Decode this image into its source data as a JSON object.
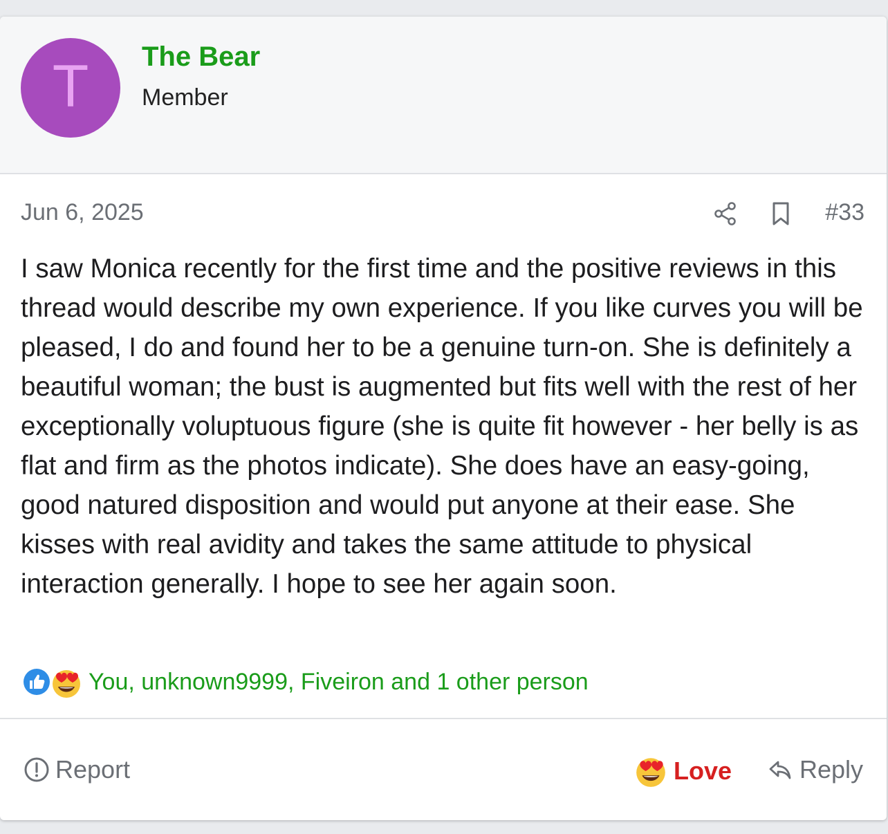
{
  "author": {
    "avatar_letter": "T",
    "avatar_color": "#a74bbd",
    "name": "The Bear",
    "name_color": "#1a9c1a",
    "title": "Member"
  },
  "post": {
    "date": "Jun 6, 2025",
    "number": "#33",
    "body": "I saw Monica recently for the first time and the positive reviews in this thread would describe my own experience. If you like curves you will be pleased, I do and found her to be a genuine turn-on. She is definitely a beautiful woman; the bust is augmented but fits well with the rest of her exceptionally voluptuous figure (she is quite fit however - her belly is as flat and firm as the photos indicate). She does have an easy-going, good natured disposition and would put anyone at their ease. She kisses with real avidity and takes the same attitude to physical interaction generally. I hope to see her again soon.",
    "icons": [
      "share-icon",
      "bookmark-icon"
    ]
  },
  "reactions": {
    "icons": [
      "like-reaction-icon",
      "love-reaction-icon"
    ],
    "summary": "You, unknown9999, Fiveiron and 1 other person"
  },
  "actions": {
    "report_label": "Report",
    "love_label": "Love",
    "reply_label": "Reply",
    "love_color": "#d62020"
  }
}
